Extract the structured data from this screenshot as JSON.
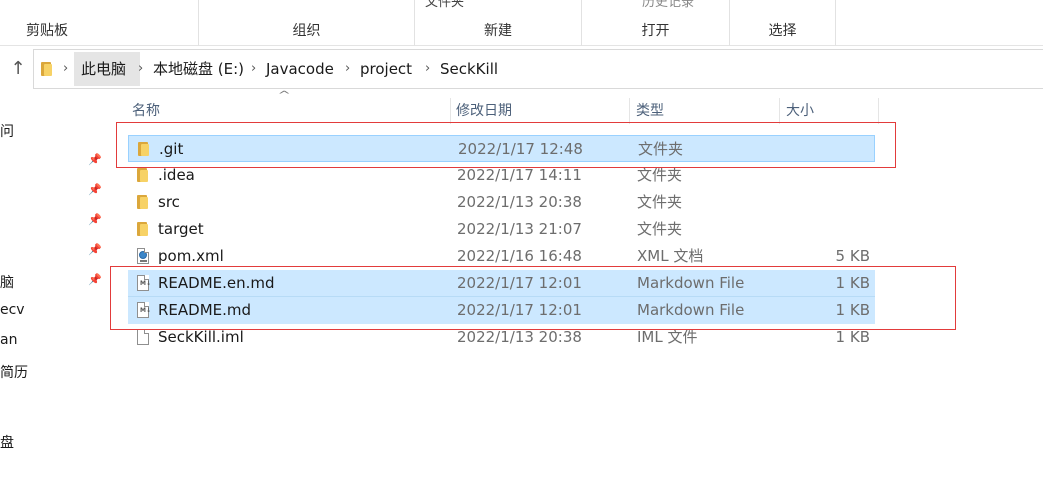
{
  "ribbon": {
    "groups": [
      {
        "label": "剪贴板"
      },
      {
        "label": "组织"
      },
      {
        "label": "新建",
        "top_partial": "文件夹"
      },
      {
        "label": "打开",
        "top_partial": "历史记录"
      },
      {
        "label": "选择"
      }
    ]
  },
  "address": {
    "crumbs": [
      "此电脑",
      "本地磁盘 (E:)",
      "Javacode",
      "project",
      "SeckKill"
    ]
  },
  "sidebar": {
    "items": [
      "问",
      "脑",
      "ecv",
      "an",
      "简历",
      "盘"
    ]
  },
  "columns": {
    "name": "名称",
    "date": "修改日期",
    "type": "类型",
    "size": "大小"
  },
  "files": [
    {
      "name": ".git",
      "date": "2022/1/17 12:48",
      "type": "文件夹",
      "size": "",
      "icon": "folder-icon",
      "selected": true
    },
    {
      "name": ".idea",
      "date": "2022/1/17 14:11",
      "type": "文件夹",
      "size": "",
      "icon": "folder-icon",
      "selected": false
    },
    {
      "name": "src",
      "date": "2022/1/13 20:38",
      "type": "文件夹",
      "size": "",
      "icon": "folder-icon",
      "selected": false
    },
    {
      "name": "target",
      "date": "2022/1/13 21:07",
      "type": "文件夹",
      "size": "",
      "icon": "folder-icon",
      "selected": false
    },
    {
      "name": "pom.xml",
      "date": "2022/1/16 16:48",
      "type": "XML 文档",
      "size": "5 KB",
      "icon": "xml-file-icon",
      "selected": false
    },
    {
      "name": "README.en.md",
      "date": "2022/1/17 12:01",
      "type": "Markdown File",
      "size": "1 KB",
      "icon": "markdown-file-icon",
      "selected": true
    },
    {
      "name": "README.md",
      "date": "2022/1/17 12:01",
      "type": "Markdown File",
      "size": "1 KB",
      "icon": "markdown-file-icon",
      "selected": true
    },
    {
      "name": "SeckKill.iml",
      "date": "2022/1/13 20:38",
      "type": "IML 文件",
      "size": "1 KB",
      "icon": "iml-file-icon",
      "selected": false
    }
  ],
  "colors": {
    "selection": "#cce8ff",
    "annotation": "#e23b3b",
    "folder": "#f7d266"
  }
}
